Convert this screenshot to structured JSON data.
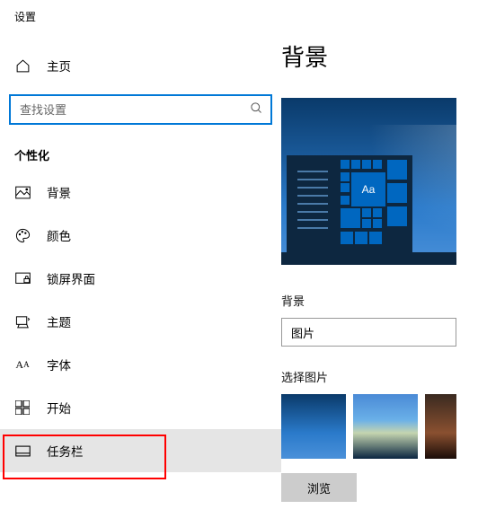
{
  "window_title": "设置",
  "sidebar": {
    "home_label": "主页",
    "search_placeholder": "查找设置",
    "section_title": "个性化",
    "items": [
      {
        "label": "背景"
      },
      {
        "label": "颜色"
      },
      {
        "label": "锁屏界面"
      },
      {
        "label": "主题"
      },
      {
        "label": "字体"
      },
      {
        "label": "开始"
      },
      {
        "label": "任务栏"
      }
    ]
  },
  "main": {
    "title": "背景",
    "preview_tile_text": "Aa",
    "bg_label": "背景",
    "bg_dropdown_value": "图片",
    "choose_image_label": "选择图片",
    "browse_label": "浏览"
  }
}
